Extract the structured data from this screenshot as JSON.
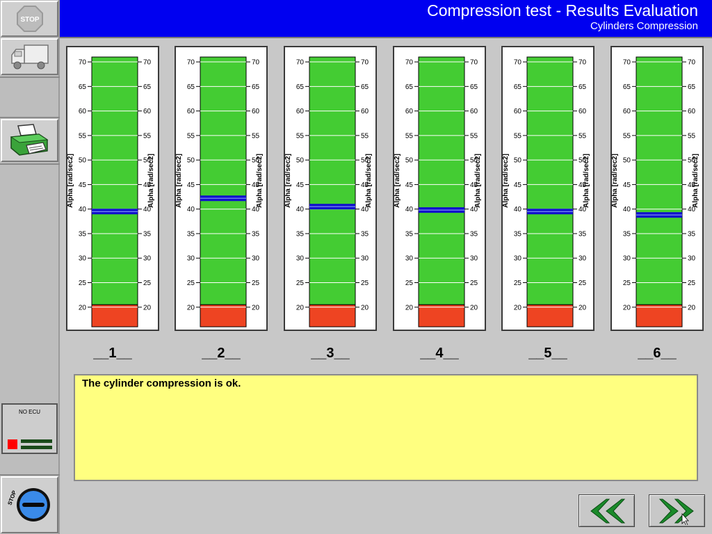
{
  "header": {
    "title": "Compression test - Results Evaluation",
    "subtitle": "Cylinders Compression"
  },
  "sidebar": {
    "stop_top_label": "STOP",
    "stop_bottom_label": "STOP",
    "ecu_status": "NO ECU"
  },
  "colors": {
    "header_bg": "#0000f0",
    "ok_zone": "#44cc33",
    "fail_zone": "#ee4422",
    "marker": "#1111cc",
    "message_bg": "#ffff80",
    "nav_arrows": "#1a8a2a"
  },
  "chart_data": {
    "type": "bar",
    "axis_label": "Alpha [rad/sec2]",
    "ticks": [
      20,
      25,
      30,
      35,
      40,
      45,
      50,
      55,
      60,
      65,
      70
    ],
    "ylim": [
      16,
      71
    ],
    "fail_threshold": 20.5,
    "categories": [
      "__1__",
      "__2__",
      "__3__",
      "__4__",
      "__5__",
      "__6__"
    ],
    "values": [
      39.5,
      42.2,
      40.5,
      39.8,
      39.5,
      38.8
    ]
  },
  "message": {
    "text": "The cylinder compression is ok."
  },
  "nav": {
    "back_icon": "double-chevron-left-icon",
    "forward_icon": "double-chevron-right-icon"
  }
}
